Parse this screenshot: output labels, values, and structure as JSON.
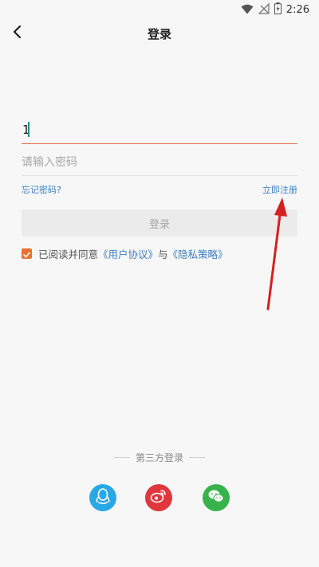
{
  "status_bar": {
    "time": "2:26"
  },
  "header": {
    "title": "登录"
  },
  "form": {
    "username": {
      "value": "1"
    },
    "password": {
      "placeholder": "请输入密码"
    },
    "forgot_label": "忘记密码?",
    "register_label": "立即注册",
    "login_label": "登录"
  },
  "agreement": {
    "checked": true,
    "prefix": "已阅读并同意",
    "user_agreement": "《用户协议》",
    "and": "与",
    "privacy_policy": "《隐私策略》"
  },
  "third_party": {
    "title": "第三方登录",
    "providers": [
      {
        "name": "qq",
        "icon": "qq-icon",
        "color": "#29a8e6"
      },
      {
        "name": "weibo",
        "icon": "weibo-icon",
        "color": "#e0363c"
      },
      {
        "name": "wechat",
        "icon": "wechat-icon",
        "color": "#36b34a"
      }
    ]
  },
  "colors": {
    "accent": "#e8732f",
    "link": "#3d7fc1",
    "underline_active": "#e26a44",
    "annotation_arrow": "#d62020"
  }
}
